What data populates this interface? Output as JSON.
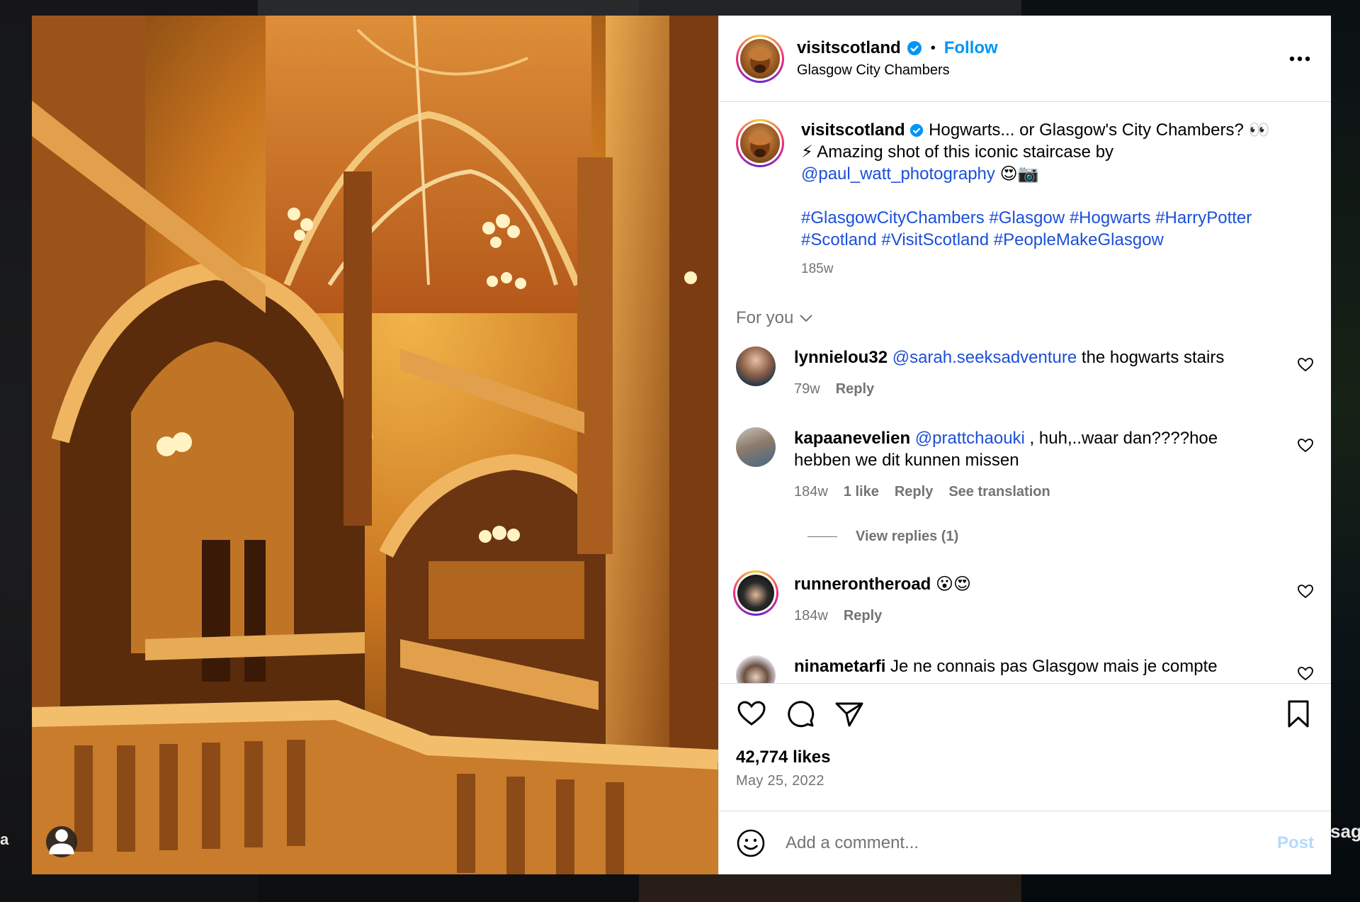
{
  "post": {
    "username": "visitscotland",
    "follow_label": "Follow",
    "dot": "•",
    "location": "Glasgow City Chambers"
  },
  "caption": {
    "username": "visitscotland",
    "text_1": "Hogwarts... or Glasgow's City Chambers? 👀",
    "text_2": "⚡ Amazing shot of this iconic staircase by",
    "mention": "@paul_watt_photography",
    "emoji_tail": "😍📷",
    "hashtags_line1": "#GlasgowCityChambers #Glasgow #Hogwarts #HarryPotter",
    "hashtags_line2": "#Scotland #VisitScotland #PeopleMakeGlasgow",
    "time": "185w"
  },
  "sort_label": "For you",
  "comments": [
    {
      "username": "lynnielou32",
      "mention": "@sarah.seeksadventure",
      "text": " the hogwarts stairs",
      "time": "79w",
      "reply": "Reply"
    },
    {
      "username": "kapaanevelien",
      "mention": "@prattchaouki",
      "text": " , huh,..waar dan????hoe hebben we dit kunnen missen",
      "time": "184w",
      "likes": "1 like",
      "reply": "Reply",
      "translate": "See translation",
      "view_replies": "View replies (1)"
    },
    {
      "username": "runnerontheroad",
      "text": " 😮😍",
      "time": "184w",
      "reply": "Reply"
    },
    {
      "username": "ninametarfi",
      "text": " Je ne connais pas Glasgow mais je compte"
    }
  ],
  "likes": "42,774 likes",
  "date": "May 25, 2022",
  "add_comment": {
    "placeholder": "Add a comment...",
    "post_label": "Post"
  },
  "background": {
    "partial_left": "a",
    "partial_right": "sage"
  },
  "colors": {
    "link": "#1c4fd8",
    "follow": "#0095f6",
    "muted": "#737373",
    "post_disabled": "#b3dbff"
  }
}
